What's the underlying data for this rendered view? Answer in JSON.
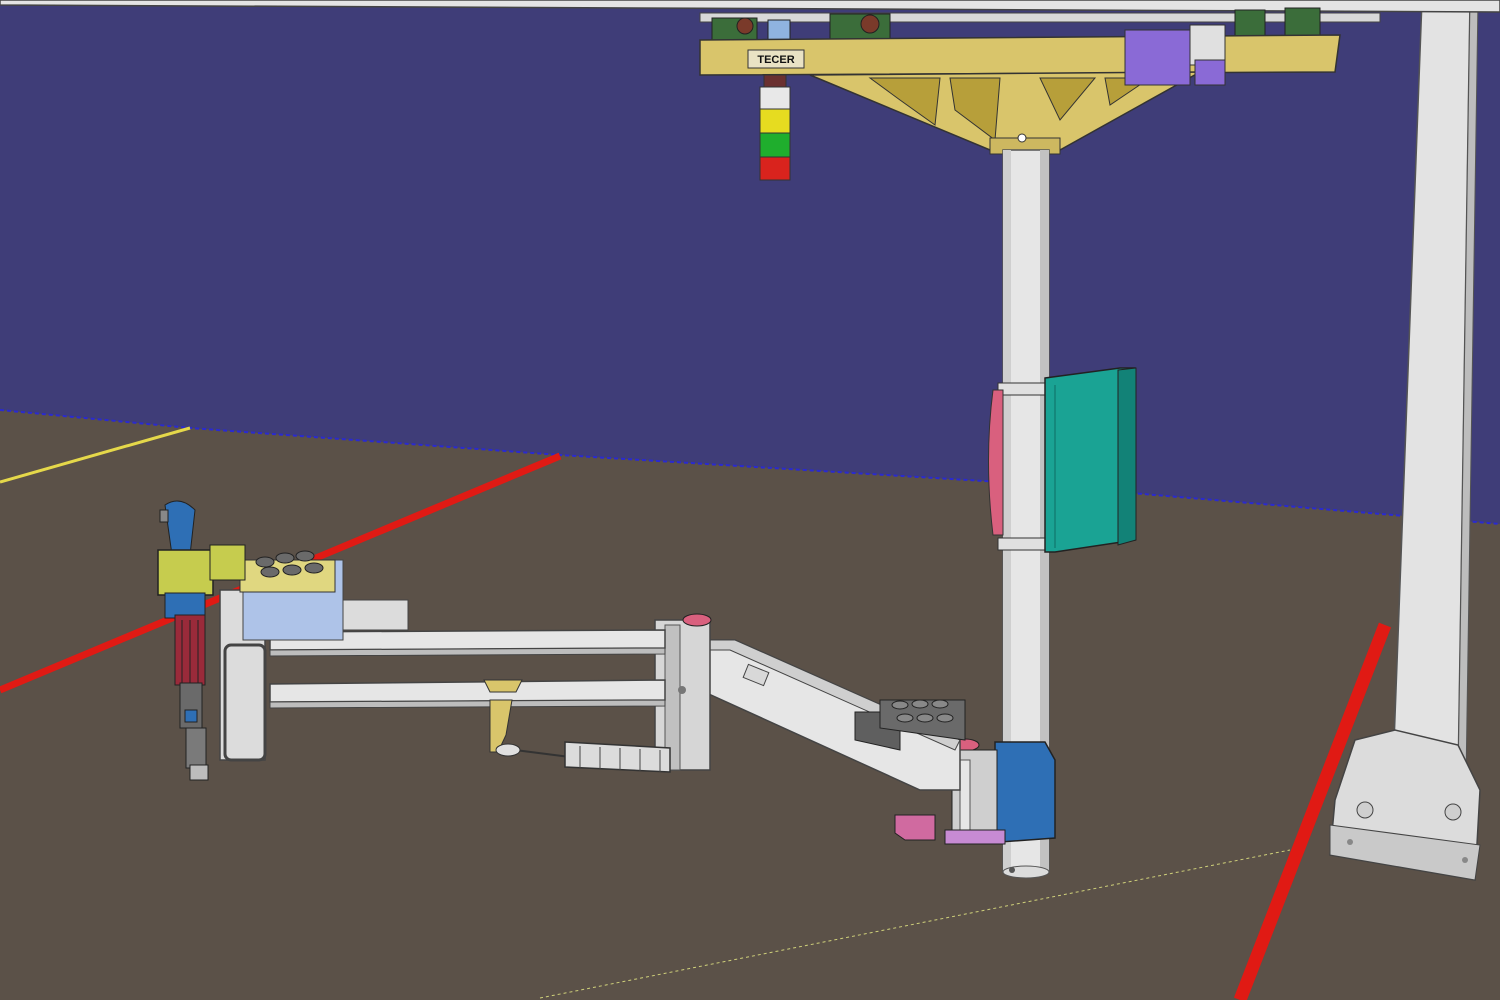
{
  "viewer": {
    "background_color": "#3f3d78",
    "floor_color": "#5b5148"
  },
  "model": {
    "brand_label": "TECER"
  },
  "colors": {
    "beam_yellow": "#d9c56b",
    "column_white": "#e6e6e6",
    "cabinet_teal": "#1aa394",
    "drive_blue": "#2e6fb5",
    "floor_red_line": "#e01a14",
    "floor_yellow_line": "#e5d84a",
    "tower_red": "#d9231d",
    "tower_green": "#1fae2d",
    "tower_yellow": "#e6dc20",
    "clamp_pink": "#d06aa0",
    "purple_block": "#8a6ad6"
  }
}
